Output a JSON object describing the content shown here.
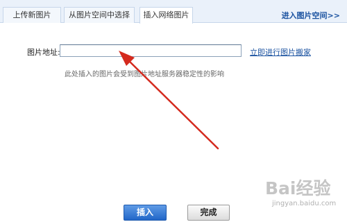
{
  "tabs": [
    {
      "label": "上传新图片",
      "active": false
    },
    {
      "label": "从图片空间中选择",
      "active": false
    },
    {
      "label": "插入网络图片",
      "active": true
    }
  ],
  "space_link": "进入图片空间>>",
  "form": {
    "url_label": "图片地址:",
    "url_value": "",
    "move_link": "立即进行图片搬家",
    "hint": "此处插入的图片会受到图片地址服务器稳定性的影响"
  },
  "buttons": {
    "insert": "插入",
    "done": "完成"
  },
  "watermark": {
    "logo": "Bai经验",
    "url": "jingyan.baidu.com"
  },
  "colors": {
    "tab_bar": "#eaf1fa",
    "link": "#1a52a0",
    "annotation_arrow": "#d42a1e",
    "insert_button": "#2166c8"
  }
}
